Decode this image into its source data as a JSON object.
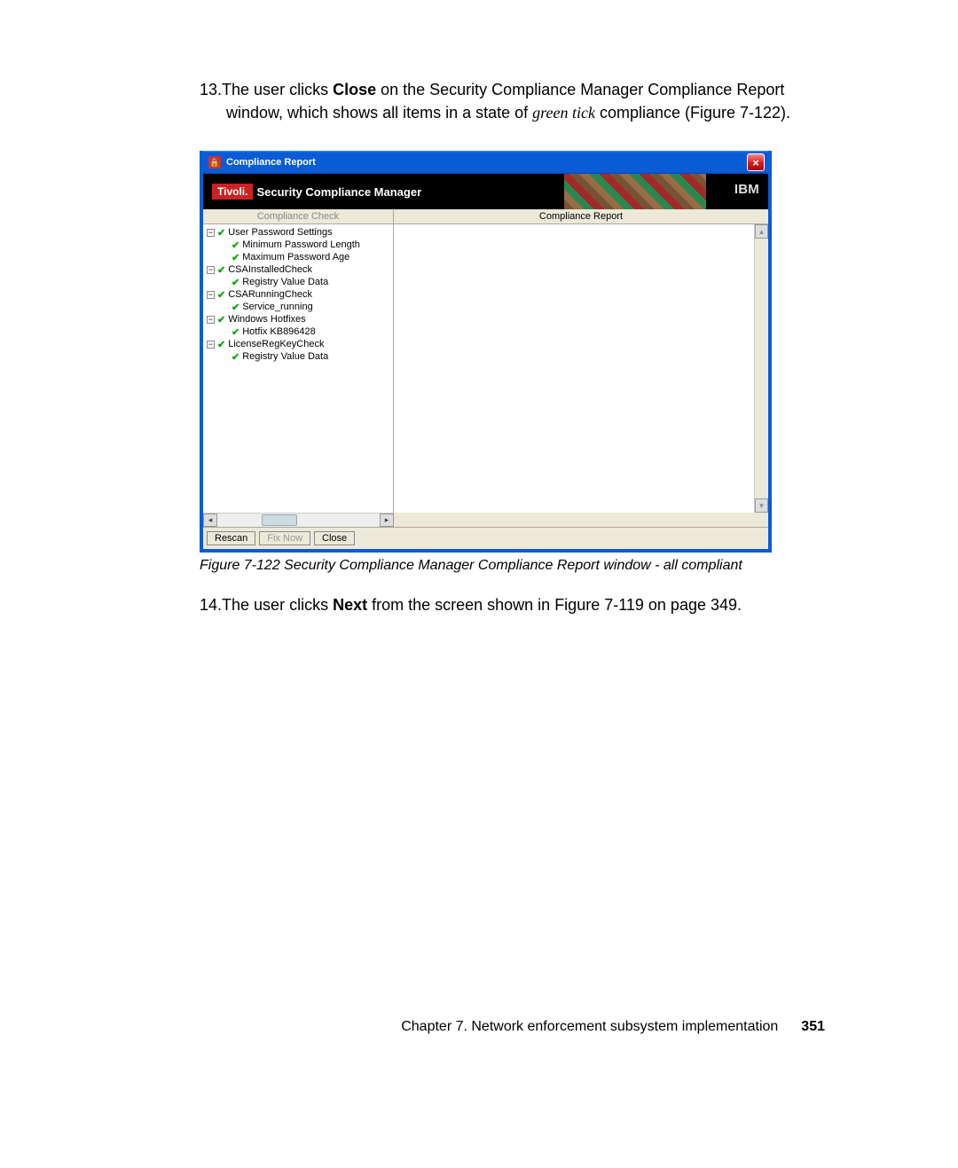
{
  "instructions": {
    "step13_num": "13.",
    "step13_a": "The user clicks ",
    "step13_close": "Close",
    "step13_b": " on the Security Compliance Manager Compliance Report window, which shows all items in a state of ",
    "step13_greentick": "green tick",
    "step13_c": " compliance (Figure 7-122).",
    "step14_num": "14.",
    "step14_a": "The user clicks ",
    "step14_next": "Next",
    "step14_b": " from the screen shown in Figure 7-119 on page 349."
  },
  "window": {
    "title": "Compliance Report",
    "banner_brand": "Tivoli.",
    "banner_title": "Security Compliance Manager",
    "ibm": "IBM",
    "col_left": "Compliance Check",
    "col_right": "Compliance Report",
    "tree": [
      {
        "label": "User Password Settings",
        "children": [
          "Minimum Password Length",
          "Maximum Password Age"
        ]
      },
      {
        "label": "CSAInstalledCheck",
        "children": [
          "Registry Value Data"
        ]
      },
      {
        "label": "CSARunningCheck",
        "children": [
          "Service_running"
        ]
      },
      {
        "label": "Windows Hotfixes",
        "children": [
          "Hotfix KB896428"
        ]
      },
      {
        "label": "LicenseRegKeyCheck",
        "children": [
          "Registry Value Data"
        ]
      }
    ],
    "buttons": {
      "rescan": "Rescan",
      "fixnow": "Fix Now",
      "close": "Close"
    }
  },
  "figure_caption": "Figure 7-122   Security Compliance Manager Compliance Report window - all compliant",
  "footer": {
    "chapter": "Chapter 7. Network enforcement subsystem implementation",
    "page": "351"
  }
}
